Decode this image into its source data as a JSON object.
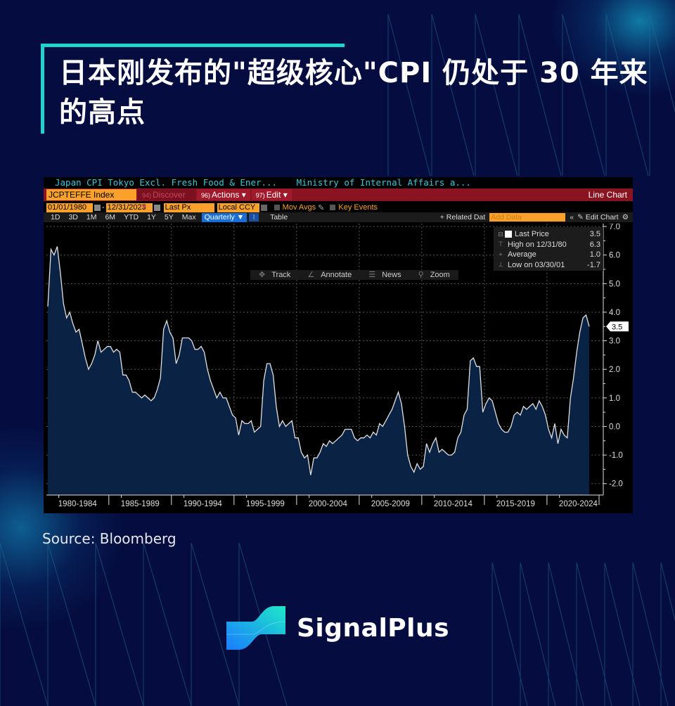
{
  "title": "日本刚发布的\"超级核心\"CPI 仍处于 30 年来的高点",
  "source": "Source: Bloomberg",
  "brand": {
    "name": "SignalPlus",
    "accent": "#1fd3cf"
  },
  "terminal": {
    "security_description": "Japan CPI Tokyo Excl. Fresh Food & Ener...",
    "source_description": "Ministry of Internal Affairs a...",
    "ticker": "JCPTEFFE Index",
    "menu": [
      {
        "num": "94)",
        "label": "Discover ▾"
      },
      {
        "num": "96)",
        "label": "Actions ▾"
      },
      {
        "num": "97)",
        "label": "Edit ▾"
      }
    ],
    "chart_type": "Line Chart",
    "start_date": "01/01/1980",
    "end_date": "12/31/2023",
    "field": "Last Px",
    "currency": "Local CCY",
    "mov_avgs": "Mov Avgs",
    "key_events": "Key Events",
    "periods": [
      "1D",
      "3D",
      "1M",
      "6M",
      "YTD",
      "1Y",
      "5Y",
      "Max"
    ],
    "frequency": "Quarterly ▼",
    "table_label": "Table",
    "related_data": "+ Related Dat",
    "add_data_placeholder": "Add Data",
    "edit_chart": "Edit Chart",
    "tools": [
      "Track",
      "Annotate",
      "News",
      "Zoom"
    ],
    "legend": [
      {
        "label": "Last Price",
        "value": "3.5"
      },
      {
        "label": "High on 12/31/80",
        "value": "6.3"
      },
      {
        "label": "Average",
        "value": "1.0"
      },
      {
        "label": "Low on 03/30/01",
        "value": "-1.7"
      }
    ],
    "last_value_tag": "3.5"
  },
  "chart_data": {
    "type": "area",
    "title": "Japan CPI Tokyo Excl. Fresh Food & Energy YoY",
    "frequency": "quarterly",
    "x_start": "1980Q1",
    "x_end": "2023Q4",
    "xlabel": "",
    "ylabel": "",
    "ylim": [
      -2.4,
      7.1
    ],
    "yticks": [
      7.0,
      6.0,
      5.0,
      4.0,
      3.0,
      2.0,
      1.0,
      0.0,
      -1.0,
      -2.0
    ],
    "ytick_labels": [
      "7.0",
      "6.0",
      "5.0",
      "4.0",
      "3.0",
      "2.0",
      "1.0",
      "0.0",
      "-1.0",
      "-2.0"
    ],
    "xtick_labels": [
      "1980-1984",
      "1985-1989",
      "1990-1994",
      "1995-1999",
      "2000-2004",
      "2005-2009",
      "2010-2014",
      "2015-2019",
      "2020-2024"
    ],
    "grid": true,
    "color_line": "#e0e0e0",
    "color_fill": "#0a2344",
    "values": [
      4.2,
      6.2,
      6.0,
      6.3,
      5.4,
      4.3,
      3.8,
      4.0,
      3.6,
      3.3,
      3.4,
      2.9,
      2.4,
      2.0,
      2.2,
      2.5,
      3.0,
      2.6,
      2.7,
      2.8,
      2.8,
      2.6,
      2.7,
      2.6,
      1.8,
      1.8,
      1.6,
      1.2,
      1.2,
      1.1,
      1.0,
      1.1,
      1.0,
      0.9,
      1.0,
      1.3,
      1.7,
      3.4,
      3.7,
      3.3,
      3.1,
      2.2,
      2.5,
      3.1,
      3.1,
      3.1,
      3.0,
      2.7,
      2.7,
      2.8,
      2.6,
      2.0,
      1.6,
      1.3,
      1.0,
      1.2,
      1.0,
      1.0,
      0.7,
      0.4,
      0.3,
      -0.3,
      0.2,
      0.1,
      0.1,
      0.2,
      -0.2,
      -0.1,
      0.0,
      1.6,
      2.2,
      2.2,
      1.8,
      0.7,
      0.0,
      0.2,
      0.0,
      0.1,
      0.2,
      -0.4,
      -0.4,
      -0.9,
      -1.1,
      -1.0,
      -1.7,
      -1.1,
      -1.1,
      -0.9,
      -0.6,
      -0.7,
      -0.5,
      -0.6,
      -0.5,
      -0.4,
      -0.3,
      -0.1,
      -0.1,
      -0.1,
      -0.4,
      -0.5,
      -0.4,
      -0.4,
      -0.3,
      -0.4,
      -0.2,
      -0.3,
      0.1,
      0.0,
      0.2,
      0.4,
      0.6,
      0.9,
      1.2,
      0.8,
      0.0,
      -1.0,
      -1.4,
      -1.6,
      -1.3,
      -1.5,
      -1.4,
      -0.6,
      -0.9,
      -0.6,
      -0.4,
      -0.9,
      -0.8,
      -0.9,
      -1.0,
      -1.0,
      -0.9,
      -0.4,
      -0.2,
      0.4,
      0.6,
      2.3,
      2.4,
      2.1,
      2.1,
      0.5,
      0.8,
      1.0,
      0.9,
      0.5,
      0.1,
      -0.1,
      -0.2,
      -0.2,
      0.0,
      0.4,
      0.5,
      0.4,
      0.7,
      0.6,
      0.7,
      0.8,
      0.6,
      0.9,
      0.7,
      0.4,
      -0.1,
      -0.4,
      0.1,
      -0.6,
      -0.1,
      -0.3,
      -0.4,
      1.0,
      1.7,
      2.6,
      3.3,
      3.8,
      3.9,
      3.5
    ],
    "last_value": 3.5,
    "high": {
      "label": "High on 12/31/80",
      "value": 6.3
    },
    "average": 1.0,
    "low": {
      "label": "Low on 03/30/01",
      "value": -1.7
    }
  }
}
